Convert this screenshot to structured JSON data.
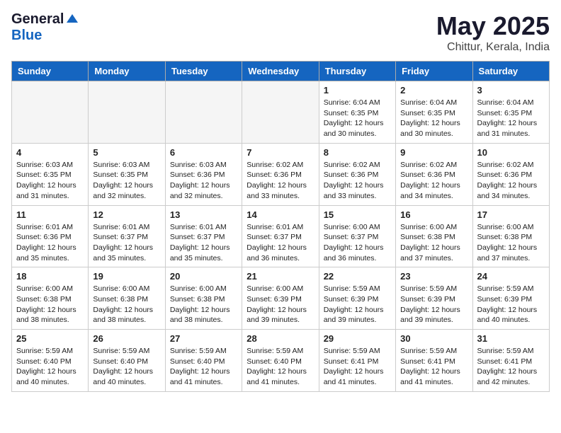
{
  "logo": {
    "general": "General",
    "blue": "Blue"
  },
  "title": "May 2025",
  "location": "Chittur, Kerala, India",
  "days_of_week": [
    "Sunday",
    "Monday",
    "Tuesday",
    "Wednesday",
    "Thursday",
    "Friday",
    "Saturday"
  ],
  "weeks": [
    [
      {
        "num": "",
        "info": ""
      },
      {
        "num": "",
        "info": ""
      },
      {
        "num": "",
        "info": ""
      },
      {
        "num": "",
        "info": ""
      },
      {
        "num": "1",
        "info": "Sunrise: 6:04 AM\nSunset: 6:35 PM\nDaylight: 12 hours\nand 30 minutes."
      },
      {
        "num": "2",
        "info": "Sunrise: 6:04 AM\nSunset: 6:35 PM\nDaylight: 12 hours\nand 30 minutes."
      },
      {
        "num": "3",
        "info": "Sunrise: 6:04 AM\nSunset: 6:35 PM\nDaylight: 12 hours\nand 31 minutes."
      }
    ],
    [
      {
        "num": "4",
        "info": "Sunrise: 6:03 AM\nSunset: 6:35 PM\nDaylight: 12 hours\nand 31 minutes."
      },
      {
        "num": "5",
        "info": "Sunrise: 6:03 AM\nSunset: 6:35 PM\nDaylight: 12 hours\nand 32 minutes."
      },
      {
        "num": "6",
        "info": "Sunrise: 6:03 AM\nSunset: 6:36 PM\nDaylight: 12 hours\nand 32 minutes."
      },
      {
        "num": "7",
        "info": "Sunrise: 6:02 AM\nSunset: 6:36 PM\nDaylight: 12 hours\nand 33 minutes."
      },
      {
        "num": "8",
        "info": "Sunrise: 6:02 AM\nSunset: 6:36 PM\nDaylight: 12 hours\nand 33 minutes."
      },
      {
        "num": "9",
        "info": "Sunrise: 6:02 AM\nSunset: 6:36 PM\nDaylight: 12 hours\nand 34 minutes."
      },
      {
        "num": "10",
        "info": "Sunrise: 6:02 AM\nSunset: 6:36 PM\nDaylight: 12 hours\nand 34 minutes."
      }
    ],
    [
      {
        "num": "11",
        "info": "Sunrise: 6:01 AM\nSunset: 6:36 PM\nDaylight: 12 hours\nand 35 minutes."
      },
      {
        "num": "12",
        "info": "Sunrise: 6:01 AM\nSunset: 6:37 PM\nDaylight: 12 hours\nand 35 minutes."
      },
      {
        "num": "13",
        "info": "Sunrise: 6:01 AM\nSunset: 6:37 PM\nDaylight: 12 hours\nand 35 minutes."
      },
      {
        "num": "14",
        "info": "Sunrise: 6:01 AM\nSunset: 6:37 PM\nDaylight: 12 hours\nand 36 minutes."
      },
      {
        "num": "15",
        "info": "Sunrise: 6:00 AM\nSunset: 6:37 PM\nDaylight: 12 hours\nand 36 minutes."
      },
      {
        "num": "16",
        "info": "Sunrise: 6:00 AM\nSunset: 6:38 PM\nDaylight: 12 hours\nand 37 minutes."
      },
      {
        "num": "17",
        "info": "Sunrise: 6:00 AM\nSunset: 6:38 PM\nDaylight: 12 hours\nand 37 minutes."
      }
    ],
    [
      {
        "num": "18",
        "info": "Sunrise: 6:00 AM\nSunset: 6:38 PM\nDaylight: 12 hours\nand 38 minutes."
      },
      {
        "num": "19",
        "info": "Sunrise: 6:00 AM\nSunset: 6:38 PM\nDaylight: 12 hours\nand 38 minutes."
      },
      {
        "num": "20",
        "info": "Sunrise: 6:00 AM\nSunset: 6:38 PM\nDaylight: 12 hours\nand 38 minutes."
      },
      {
        "num": "21",
        "info": "Sunrise: 6:00 AM\nSunset: 6:39 PM\nDaylight: 12 hours\nand 39 minutes."
      },
      {
        "num": "22",
        "info": "Sunrise: 5:59 AM\nSunset: 6:39 PM\nDaylight: 12 hours\nand 39 minutes."
      },
      {
        "num": "23",
        "info": "Sunrise: 5:59 AM\nSunset: 6:39 PM\nDaylight: 12 hours\nand 39 minutes."
      },
      {
        "num": "24",
        "info": "Sunrise: 5:59 AM\nSunset: 6:39 PM\nDaylight: 12 hours\nand 40 minutes."
      }
    ],
    [
      {
        "num": "25",
        "info": "Sunrise: 5:59 AM\nSunset: 6:40 PM\nDaylight: 12 hours\nand 40 minutes."
      },
      {
        "num": "26",
        "info": "Sunrise: 5:59 AM\nSunset: 6:40 PM\nDaylight: 12 hours\nand 40 minutes."
      },
      {
        "num": "27",
        "info": "Sunrise: 5:59 AM\nSunset: 6:40 PM\nDaylight: 12 hours\nand 41 minutes."
      },
      {
        "num": "28",
        "info": "Sunrise: 5:59 AM\nSunset: 6:40 PM\nDaylight: 12 hours\nand 41 minutes."
      },
      {
        "num": "29",
        "info": "Sunrise: 5:59 AM\nSunset: 6:41 PM\nDaylight: 12 hours\nand 41 minutes."
      },
      {
        "num": "30",
        "info": "Sunrise: 5:59 AM\nSunset: 6:41 PM\nDaylight: 12 hours\nand 41 minutes."
      },
      {
        "num": "31",
        "info": "Sunrise: 5:59 AM\nSunset: 6:41 PM\nDaylight: 12 hours\nand 42 minutes."
      }
    ]
  ]
}
